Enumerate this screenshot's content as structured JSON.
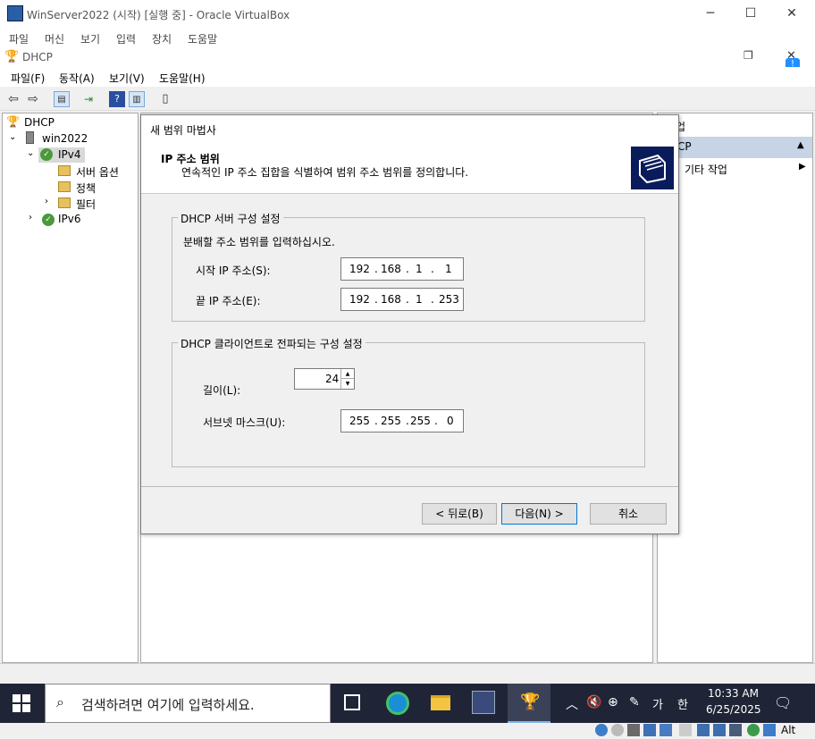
{
  "vbox": {
    "title": "WinServer2022 (시작) [실행 중] - Oracle VirtualBox",
    "menu": [
      "파일",
      "머신",
      "보기",
      "입력",
      "장치",
      "도움말"
    ]
  },
  "mmc": {
    "title": "DHCP",
    "menu": [
      "파일(F)",
      "동작(A)",
      "보기(V)",
      "도움말(H)"
    ],
    "tree": {
      "root": "DHCP",
      "server": "win2022",
      "ipv4": "IPv4",
      "server_options": "서버 옵션",
      "policies": "정책",
      "filters": "필터",
      "ipv6": "IPv6"
    },
    "actions": {
      "header": "업",
      "section": "CP",
      "more": "기타 작업"
    }
  },
  "wizard": {
    "title": "새 범위 마법사",
    "header_title": "IP 주소 범위",
    "header_desc": "연속적인 IP 주소 집합을 식별하여 범위 주소 범위를 정의합니다.",
    "server_group": {
      "legend": "DHCP 서버 구성 설정",
      "instruction": "분배할 주소 범위를 입력하십시오.",
      "start_label": "시작 IP 주소(S):",
      "start_ip": [
        "192",
        "168",
        "1",
        "1"
      ],
      "end_label": "끝 IP 주소(E):",
      "end_ip": [
        "192",
        "168",
        "1",
        "253"
      ]
    },
    "client_group": {
      "legend": "DHCP 클라이언트로 전파되는 구성 설정",
      "length_label": "길이(L):",
      "length_value": "24",
      "mask_label": "서브넷 마스크(U):",
      "mask": [
        "255",
        "255",
        "255",
        "0"
      ]
    },
    "buttons": {
      "back": "< 뒤로(B)",
      "next": "다음(N) >",
      "cancel": "취소"
    }
  },
  "taskbar": {
    "search_placeholder": "검색하려면 여기에 입력하세요.",
    "ime": "가",
    "ime2": "한",
    "time": "10:33 AM",
    "date": "6/25/2025"
  },
  "vbox_status": {
    "host_key": "Alt"
  },
  "colors": {
    "taskbar": "#1f2536",
    "accent": "#0078d7",
    "wizard_header_icon_bg": "#0a1b5c"
  }
}
